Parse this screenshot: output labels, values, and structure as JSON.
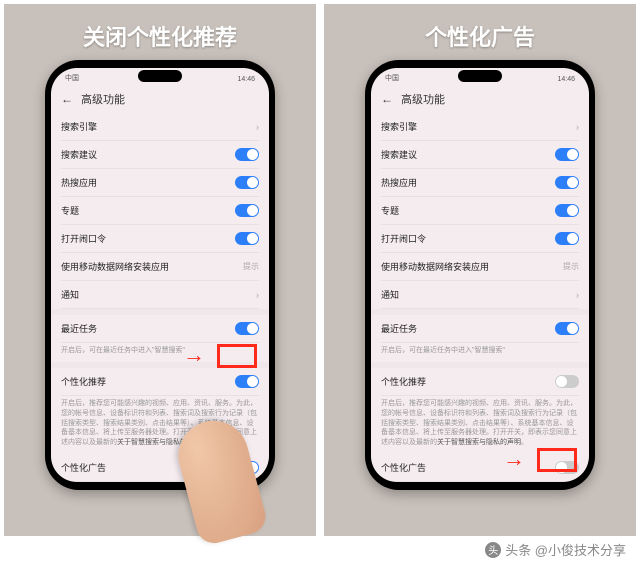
{
  "left": {
    "title": "关闭个性化推荐",
    "status": {
      "carrier": "中国",
      "time": "14:46"
    }
  },
  "right": {
    "title": "个性化广告",
    "status": {
      "carrier": "中国",
      "time": "14:46"
    }
  },
  "header": {
    "title": "高级功能"
  },
  "rows": {
    "search_engine": "搜索引擎",
    "search_suggest": "搜索建议",
    "hot_apps": "热搜应用",
    "topics": "专题",
    "open_password": "打开闹口令",
    "mobile_data_install": "使用移动数据网络安装应用",
    "mobile_data_hint": "提示",
    "notifications": "通知",
    "recent_tasks": "最近任务",
    "recent_tasks_desc": "开启后，可在最近任务中进入\"智慧搜索\"",
    "personalized_rec": "个性化推荐",
    "personalized_rec_desc_1": "开启后，推荐您可能感兴趣的视频、应用、资讯、服务。为此，您的帐号信息、设备标识符和列表、搜索词及搜索行为记录（包括搜索类型、搜索结果类别、点击结果等）、系统基本信息、设备基本信息、将上传至服务器处理。打开开关，即表示您同意上述内容以及最新的",
    "personalized_rec_desc_2": "关于智慧搜索与隐私的声明",
    "personalized_rec_desc_3": "。",
    "personalized_ads": "个性化广告"
  },
  "watermark": "头条 @小俊技术分享"
}
